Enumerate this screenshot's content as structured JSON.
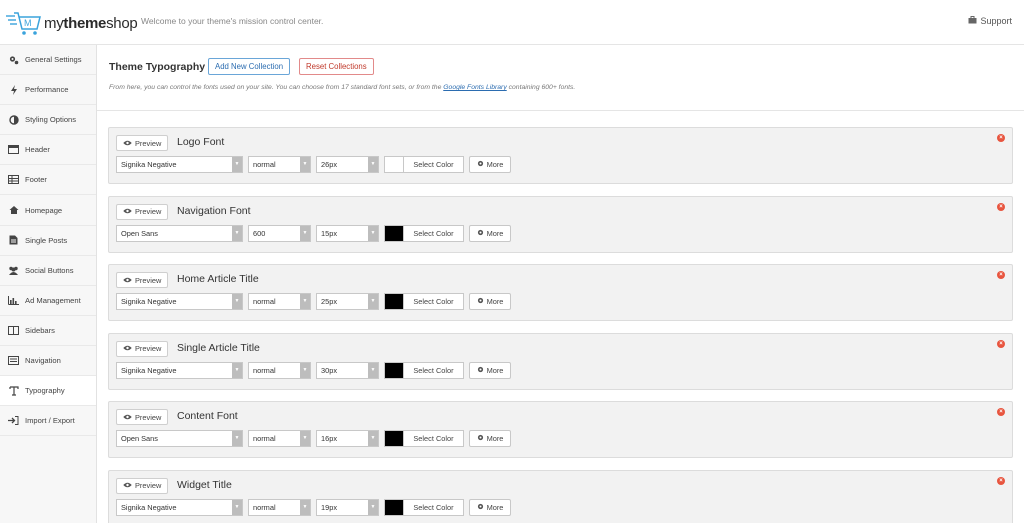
{
  "brand": {
    "prefix": "my",
    "bold": "theme",
    "suffix": "shop",
    "tagline": "Welcome to your theme's mission control center."
  },
  "topbar": {
    "support_label": "Support"
  },
  "sidebar": {
    "items": [
      {
        "label": "General Settings",
        "icon": "gears-icon"
      },
      {
        "label": "Performance",
        "icon": "bolt-icon"
      },
      {
        "label": "Styling Options",
        "icon": "contrast-icon"
      },
      {
        "label": "Header",
        "icon": "header-icon"
      },
      {
        "label": "Footer",
        "icon": "table-icon"
      },
      {
        "label": "Homepage",
        "icon": "home-icon"
      },
      {
        "label": "Single Posts",
        "icon": "document-icon"
      },
      {
        "label": "Social Buttons",
        "icon": "users-icon"
      },
      {
        "label": "Ad Management",
        "icon": "bar-chart-icon"
      },
      {
        "label": "Sidebars",
        "icon": "columns-icon"
      },
      {
        "label": "Navigation",
        "icon": "list-icon"
      },
      {
        "label": "Typography",
        "icon": "text-icon"
      },
      {
        "label": "Import / Export",
        "icon": "sign-in-icon"
      }
    ]
  },
  "main": {
    "title": "Theme Typography",
    "add_label": "Add New Collection",
    "reset_label": "Reset Collections",
    "desc_before": "From here, you can control the fonts used on your site. You can choose from 17 standard font sets, or from the ",
    "desc_link": "Google Fonts Library",
    "desc_after": " containing 600+ fonts."
  },
  "labels": {
    "preview": "Preview",
    "select_color": "Select Color",
    "more": "More"
  },
  "font_blocks": [
    {
      "name": "Logo Font",
      "family": "Signika Negative",
      "weight": "normal",
      "size": "26px",
      "color": "#ffffff"
    },
    {
      "name": "Navigation Font",
      "family": "Open Sans",
      "weight": "600",
      "size": "15px",
      "color": "#000000"
    },
    {
      "name": "Home Article Title",
      "family": "Signika Negative",
      "weight": "normal",
      "size": "25px",
      "color": "#000000"
    },
    {
      "name": "Single Article Title",
      "family": "Signika Negative",
      "weight": "normal",
      "size": "30px",
      "color": "#000000"
    },
    {
      "name": "Content Font",
      "family": "Open Sans",
      "weight": "normal",
      "size": "16px",
      "color": "#000000"
    },
    {
      "name": "Widget Title",
      "family": "Signika Negative",
      "weight": "normal",
      "size": "19px",
      "color": "#000000"
    }
  ],
  "colors": {
    "accent_blue": "#2b6cb0",
    "accent_red": "#c0392b",
    "close_red": "#e8553f"
  }
}
